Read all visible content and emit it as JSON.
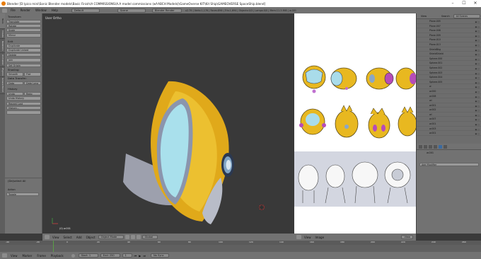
{
  "window": {
    "title": "Blender [D:\\pico mini\\Sonic Blender models\\Basic Finish\\A COMMISSIONS\\A.A model commissions (wf-ABCH Models)\\GameOverse KIT\\Kit Ship\\GAMEOVERSE SpaceShip.blend]",
    "controls": [
      "–",
      "☐",
      "✕"
    ]
  },
  "infobar": {
    "menus": [
      "File",
      "Render",
      "Window",
      "Help"
    ],
    "layout": "Default",
    "scene": "Scene",
    "engine": "Blender Render",
    "stats": "v2.79 | Verts:1,176 | Faces:896 | Tris:1,694 | Objects:0/3 | Lamps:0/0 | Mem:11.3 MiB | w.001"
  },
  "tabs": [
    "Tools",
    "Create",
    "Relations",
    "Animation",
    "Physics",
    "Grease Pencil"
  ],
  "toolshelf": {
    "transform_header": "Transform",
    "transform": [
      "Translate",
      "Rotate",
      "Scale",
      "Mirror"
    ],
    "edit_header": "Edit",
    "edit": [
      "Duplicate",
      "Duplicate Linked",
      "Delete",
      "Join"
    ],
    "set_origin": "Set Origin",
    "shading_label": "Shading:",
    "shading": [
      "Smooth",
      "Flat"
    ],
    "data_transfer_label": "Data Transfer:",
    "data": [
      "Data",
      "Data Layo"
    ],
    "history_header": "History",
    "history_row": [
      "Undo",
      "Redo"
    ],
    "history": [
      "Undo History",
      "Repeat Last",
      "History..."
    ],
    "operator_header": "(De)select All",
    "action_label": "Action",
    "action_value": "Toggle"
  },
  "viewport": {
    "label": "User Ortho",
    "object_label": "(0) w.001"
  },
  "viewport_header": {
    "items": [
      "View",
      "Select",
      "Add",
      "Object"
    ],
    "mode": "Object Mode",
    "pivot": "Global"
  },
  "image_header": {
    "items": [
      "View",
      "Image"
    ],
    "view": "View"
  },
  "outliner": {
    "items": [
      "View",
      "Search"
    ],
    "scenes": "All Scenes",
    "rows": [
      "Plane.005",
      "Plane.007",
      "Plane.008",
      "Plane.009",
      "Plane.010",
      "Plane.013",
      "ShieldBkg",
      "ShieldShield",
      "Sphere.000",
      "Sphere.001",
      "Sphere.002",
      "Sphere.003",
      "Sphere.004",
      "Sphere.005",
      "w",
      "w.000",
      "w.008",
      "wl",
      "w.001",
      "w.002",
      "wl",
      "w.007",
      "w.001",
      "w.003",
      "w.001"
    ]
  },
  "properties": {
    "object": "w.001",
    "modifier_button": "Add Modifier"
  },
  "timeline_header": {
    "items": [
      "View",
      "Marker",
      "Frame",
      "Playback"
    ],
    "start_label": "Start:",
    "start": "1",
    "end_label": "End:",
    "end": "250",
    "current": "1",
    "sync": "No Sync"
  },
  "timeline_ticks": [
    "-40",
    "-20",
    "0",
    "20",
    "40",
    "60",
    "80",
    "100",
    "120",
    "140",
    "160",
    "180",
    "200",
    "220",
    "240",
    "260"
  ]
}
